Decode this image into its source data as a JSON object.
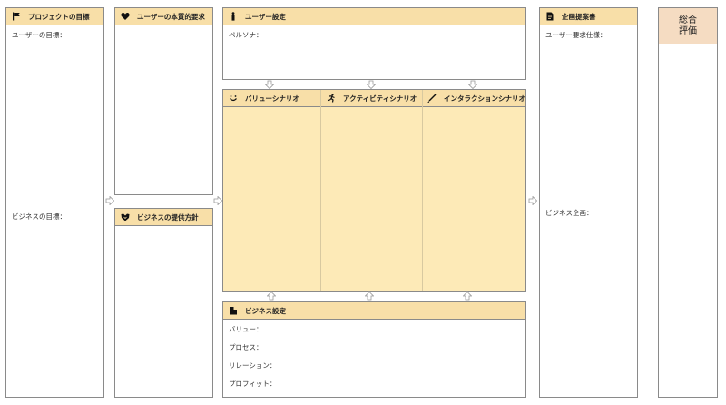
{
  "goals": {
    "title": "プロジェクトの目標",
    "user_goal_label": "ユーザーの目標：",
    "business_goal_label": "ビジネスの目標："
  },
  "essential": {
    "title": "ユーザーの本質的要求"
  },
  "policy": {
    "title": "ビジネスの提供方針"
  },
  "user_setting": {
    "title": "ユーザー設定",
    "persona_label": "ペルソナ："
  },
  "scenarios": [
    {
      "title": "バリューシナリオ",
      "icon": "smile-icon"
    },
    {
      "title": "アクティビティシナリオ",
      "icon": "running-person-icon"
    },
    {
      "title": "インタラクションシナリオ",
      "icon": "pen-icon"
    }
  ],
  "business_setting": {
    "title": "ビジネス設定",
    "items": [
      "バリュー：",
      "プロセス：",
      "リレーション：",
      "プロフィット："
    ]
  },
  "proposal": {
    "title": "企画提案書",
    "requirements_label": "ユーザー要求仕様：",
    "planning_label": "ビジネス企画："
  },
  "summary": {
    "title": "総合\n評価"
  },
  "colors": {
    "header": "#f8dfa8",
    "scenario_body": "#fdeab7",
    "summary_header": "#f5dcc2",
    "border": "#8a8a8a"
  }
}
